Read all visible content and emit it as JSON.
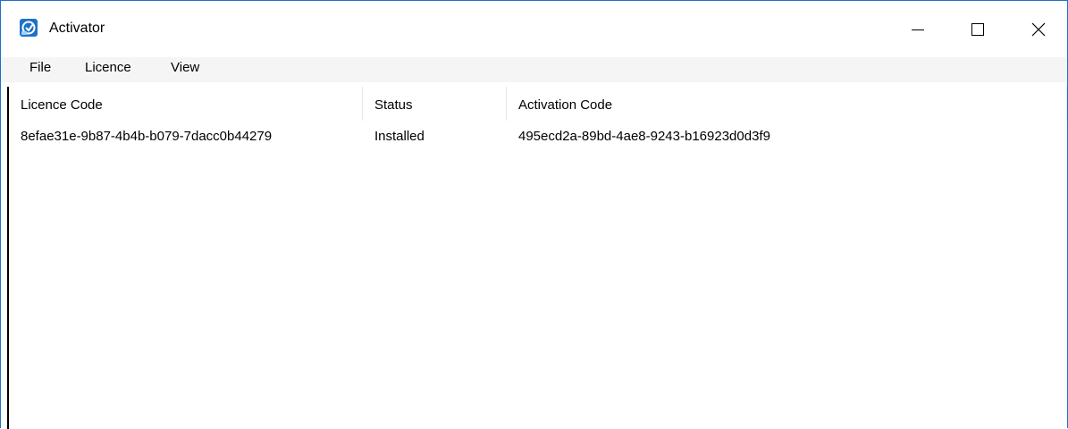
{
  "window": {
    "title": "Activator",
    "icon": "activator-app-icon"
  },
  "window_controls": {
    "minimize_icon": "minimize-icon",
    "maximize_icon": "maximize-icon",
    "close_icon": "close-icon"
  },
  "menubar": {
    "items": [
      {
        "label": "File"
      },
      {
        "label": "Licence"
      },
      {
        "label": "View"
      }
    ]
  },
  "table": {
    "columns": [
      "Licence Code",
      "Status",
      "Activation Code"
    ],
    "rows": [
      {
        "licence_code": "8efae31e-9b87-4b4b-b079-7dacc0b44279",
        "status": "Installed",
        "activation_code": "495ecd2a-89bd-4ae8-9243-b16923d0d3f9"
      }
    ]
  },
  "colors": {
    "window_border": "#1f6fc7",
    "menubar_bg": "#f5f5f5",
    "icon_blue": "#1e72c8"
  }
}
